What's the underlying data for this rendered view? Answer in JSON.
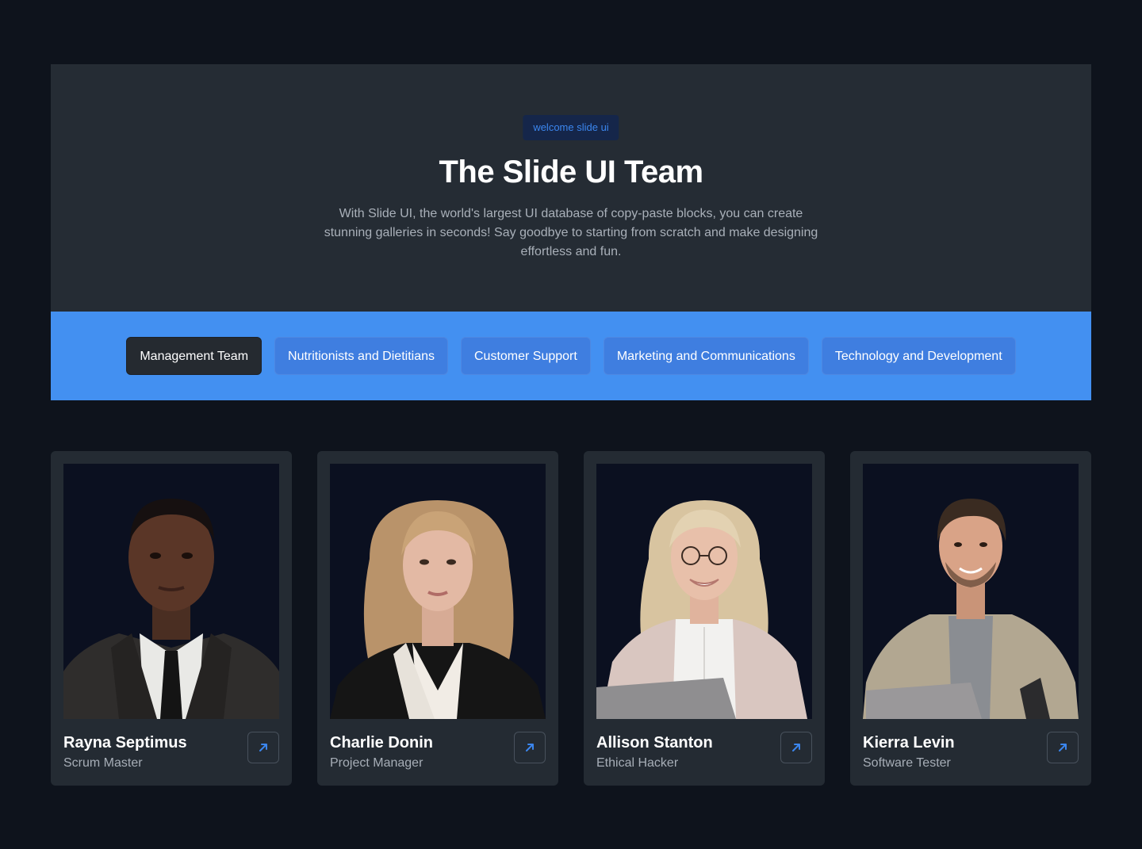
{
  "hero": {
    "badge": "welcome slide ui",
    "title": "The Slide UI Team",
    "description": "With Slide UI, the world's largest UI database of copy-paste blocks, you can create stunning galleries in seconds! Say goodbye to starting from scratch and make designing effortless and fun."
  },
  "tabs": [
    {
      "label": "Management Team",
      "active": true
    },
    {
      "label": "Nutritionists and Dietitians",
      "active": false
    },
    {
      "label": "Customer Support",
      "active": false
    },
    {
      "label": "Marketing and Communications",
      "active": false
    },
    {
      "label": "Technology and Development",
      "active": false
    }
  ],
  "members": [
    {
      "name": "Rayna Septimus",
      "role": "Scrum Master",
      "link_icon": "arrow-up-right-icon"
    },
    {
      "name": "Charlie Donin",
      "role": "Project Manager",
      "link_icon": "arrow-up-right-icon"
    },
    {
      "name": "Allison Stanton",
      "role": "Ethical Hacker",
      "link_icon": "arrow-up-right-icon"
    },
    {
      "name": "Kierra Levin",
      "role": "Software Tester",
      "link_icon": "arrow-up-right-icon"
    }
  ],
  "colors": {
    "page_bg": "#0e131c",
    "panel_bg": "#252c34",
    "accent": "#4390f1",
    "badge_text": "#3b86ee"
  }
}
